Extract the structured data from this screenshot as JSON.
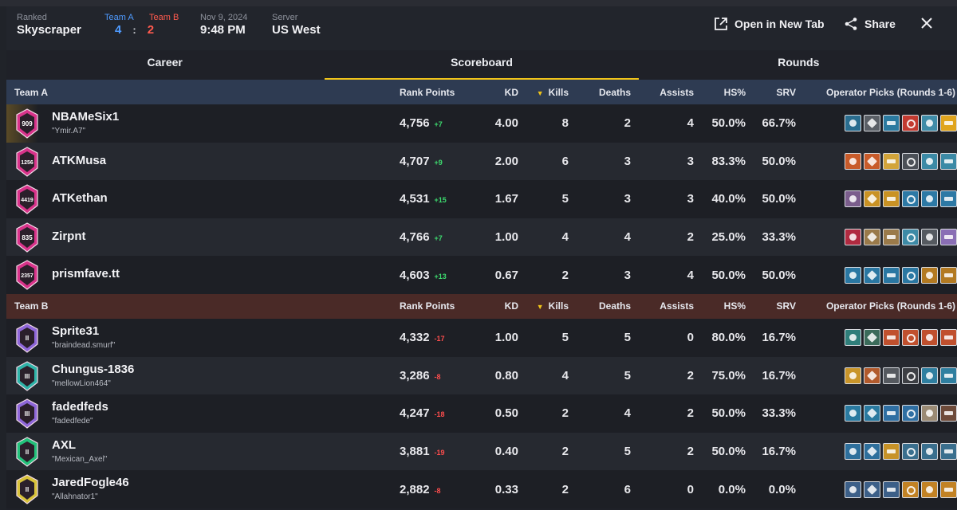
{
  "header": {
    "mode_label": "Ranked",
    "map": "Skyscraper",
    "team_a_label": "Team A",
    "team_b_label": "Team B",
    "team_a_score": "4",
    "team_b_score": "2",
    "date": "Nov 9, 2024",
    "time": "9:48 PM",
    "server_label": "Server",
    "server": "US West",
    "open_new_tab": "Open in New Tab",
    "share": "Share"
  },
  "tabs": [
    {
      "label": "Career"
    },
    {
      "label": "Scoreboard"
    },
    {
      "label": "Rounds"
    }
  ],
  "columns": {
    "rank_points": "Rank Points",
    "kd": "KD",
    "kills": "Kills",
    "deaths": "Deaths",
    "assists": "Assists",
    "hs": "HS%",
    "srv": "SRV",
    "operators": "Operator Picks (Rounds 1-6)"
  },
  "teams": [
    {
      "name": "Team A",
      "players": [
        {
          "name": "NBAMeSix1",
          "alias": "\"Ymir.A7\"",
          "rank_number": "909",
          "rank_points": "4,756",
          "delta": "+7",
          "kd": "4.00",
          "kills": "8",
          "deaths": "2",
          "assists": "4",
          "hs": "50.0%",
          "srv": "66.7%"
        },
        {
          "name": "ATKMusa",
          "alias": "",
          "rank_number": "1256",
          "rank_points": "4,707",
          "delta": "+9",
          "kd": "2.00",
          "kills": "6",
          "deaths": "3",
          "assists": "3",
          "hs": "83.3%",
          "srv": "50.0%"
        },
        {
          "name": "ATKethan",
          "alias": "",
          "rank_number": "4419",
          "rank_points": "4,531",
          "delta": "+15",
          "kd": "1.67",
          "kills": "5",
          "deaths": "3",
          "assists": "3",
          "hs": "40.0%",
          "srv": "50.0%"
        },
        {
          "name": "Zirpnt",
          "alias": "",
          "rank_number": "835",
          "rank_points": "4,766",
          "delta": "+7",
          "kd": "1.00",
          "kills": "4",
          "deaths": "4",
          "assists": "2",
          "hs": "25.0%",
          "srv": "33.3%"
        },
        {
          "name": "prismfave.tt",
          "alias": "",
          "rank_number": "2357",
          "rank_points": "4,603",
          "delta": "+13",
          "kd": "0.67",
          "kills": "2",
          "deaths": "3",
          "assists": "4",
          "hs": "50.0%",
          "srv": "50.0%"
        }
      ]
    },
    {
      "name": "Team B",
      "players": [
        {
          "name": "Sprite31",
          "alias": "\"braindead.smurf\"",
          "rank_number": "II",
          "rank_points": "4,332",
          "delta": "-17",
          "kd": "1.00",
          "kills": "5",
          "deaths": "5",
          "assists": "0",
          "hs": "80.0%",
          "srv": "16.7%"
        },
        {
          "name": "Chungus-1836",
          "alias": "\"mellowLion464\"",
          "rank_number": "III",
          "rank_points": "3,286",
          "delta": "-8",
          "kd": "0.80",
          "kills": "4",
          "deaths": "5",
          "assists": "2",
          "hs": "75.0%",
          "srv": "16.7%"
        },
        {
          "name": "fadedfeds",
          "alias": "\"fadedfede\"",
          "rank_number": "III",
          "rank_points": "4,247",
          "delta": "-18",
          "kd": "0.50",
          "kills": "2",
          "deaths": "4",
          "assists": "2",
          "hs": "50.0%",
          "srv": "33.3%"
        },
        {
          "name": "AXL",
          "alias": "\"Mexican_Axel\"",
          "rank_number": "II",
          "rank_points": "3,881",
          "delta": "-19",
          "kd": "0.40",
          "kills": "2",
          "deaths": "5",
          "assists": "2",
          "hs": "50.0%",
          "srv": "16.7%"
        },
        {
          "name": "JaredFogle46",
          "alias": "\"Allahnator1\"",
          "rank_number": "II",
          "rank_points": "2,882",
          "delta": "-8",
          "kd": "0.33",
          "kills": "2",
          "deaths": "6",
          "assists": "0",
          "hs": "0.0%",
          "srv": "0.0%"
        }
      ]
    }
  ]
}
